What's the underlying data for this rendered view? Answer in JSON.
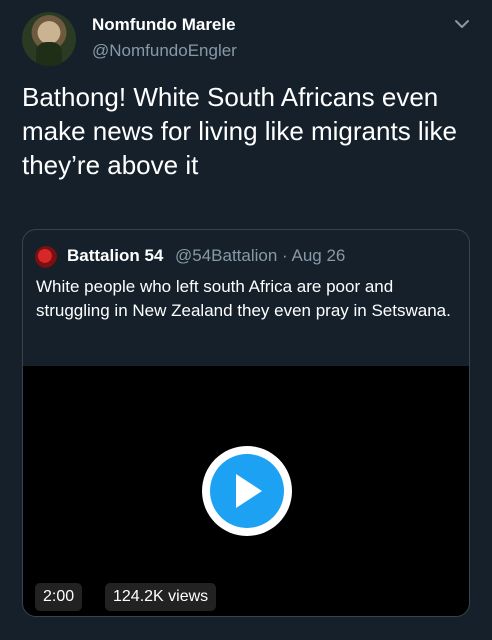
{
  "tweet": {
    "display_name": "Nomfundo Marele",
    "handle": "@NomfundoEngler",
    "text": "Bathong! White South Africans even make news for living like migrants like they’re above it",
    "menu_icon": "chevron-down-icon"
  },
  "quoted_tweet": {
    "display_name": "Battalion 54",
    "meta": "@54Battalion · Aug 26",
    "text": "White people who left south Africa are poor and struggling in New Zealand they even pray in Setswana."
  },
  "video": {
    "duration": "2:00",
    "views": "124.2K views",
    "play_icon": "play-icon"
  },
  "colors": {
    "background": "#15202b",
    "secondary_text": "#8899a6",
    "border": "#38444d",
    "accent": "#1da1f2"
  }
}
